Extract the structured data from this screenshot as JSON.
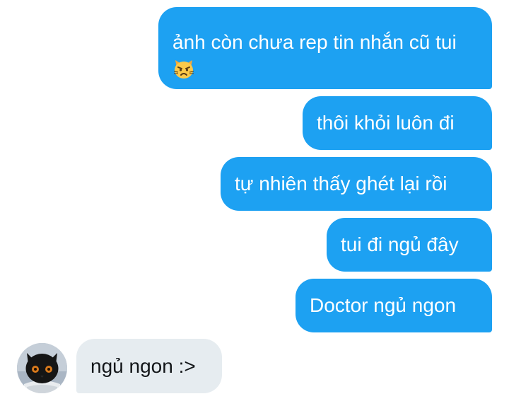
{
  "conversation": {
    "outgoing": [
      {
        "text": "ảnh còn chưa rep tin nhắn cũ tui",
        "emoji": "cat-pouting-emoji"
      },
      {
        "text": "thôi khỏi luôn đi"
      },
      {
        "text": "tự nhiên thấy ghét lại rồi"
      },
      {
        "text": "tui đi ngủ đây"
      },
      {
        "text": "Doctor ngủ ngon"
      }
    ],
    "incoming": [
      {
        "text": "ngủ ngon :>",
        "avatar": "black-cat-avatar"
      }
    ]
  },
  "colors": {
    "outgoing_bubble": "#1da1f2",
    "incoming_bubble": "#e6ecf0",
    "outgoing_text": "#ffffff",
    "incoming_text": "#14171a"
  }
}
